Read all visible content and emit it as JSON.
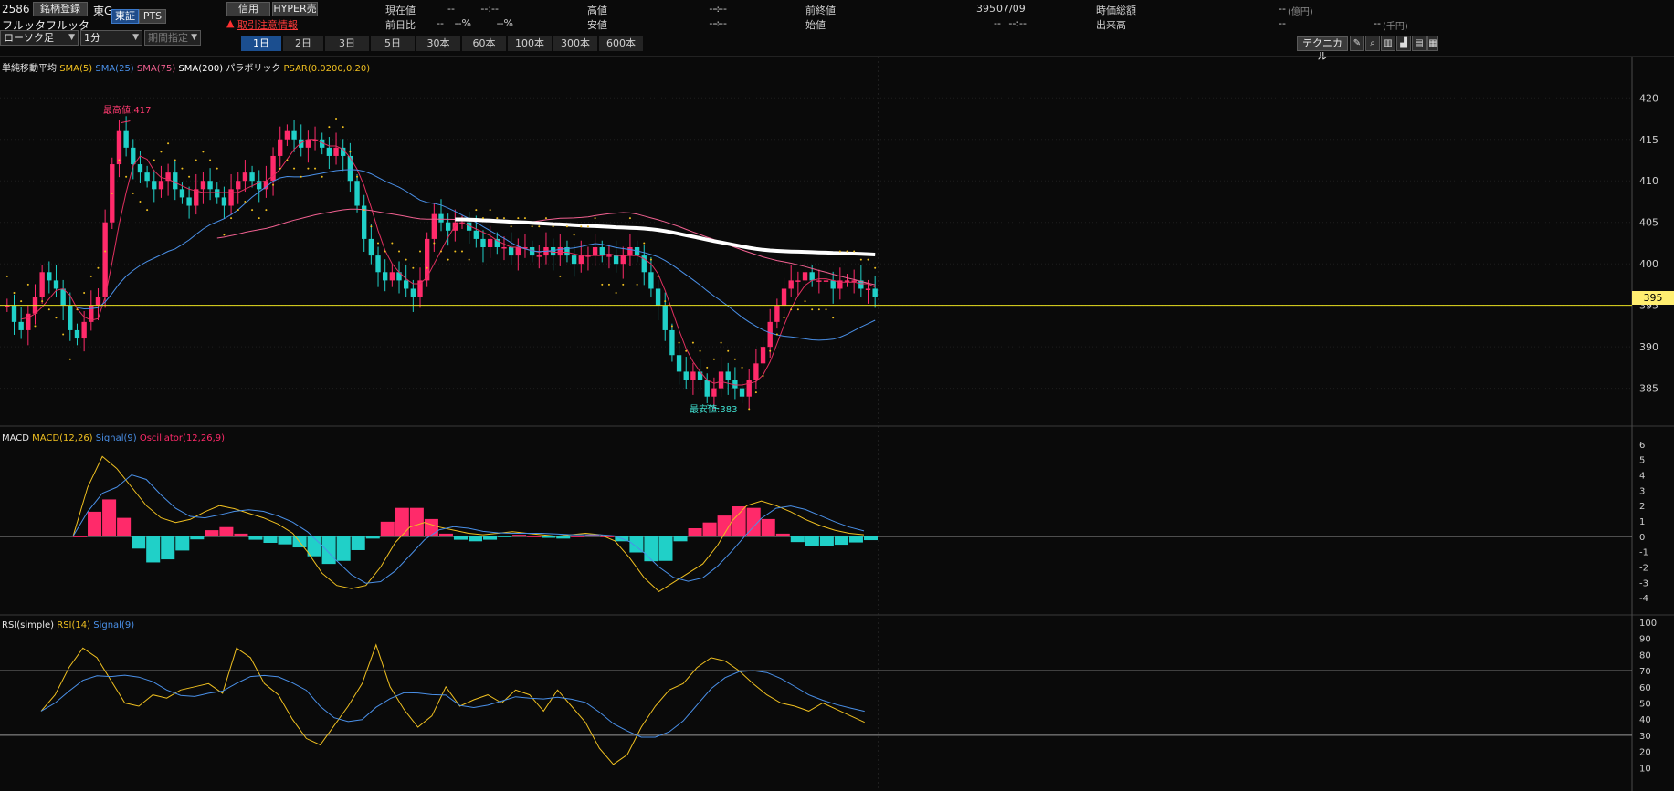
{
  "header": {
    "code": "2586",
    "register_label": "銘柄登録",
    "market": "東G",
    "exchange_tabs": [
      "東証",
      "PTS"
    ],
    "name": "フルッタフルッタ",
    "margin_button": "信用",
    "hyper_button": "HYPER売",
    "caution_text": "取引注意情報",
    "quotes": {
      "current_label": "現在値",
      "current_value": "--",
      "current_time": "--:--",
      "change_label": "前日比",
      "change_value": "--",
      "change_unit": "%",
      "change_pct": "--%",
      "high_label": "高値",
      "high_value": "--",
      "high_time": "--:--",
      "low_label": "安値",
      "low_value": "--",
      "low_time": "--:--",
      "prev_close_label": "前終値",
      "prev_close_value": "395",
      "prev_close_date": "07/09",
      "open_label": "始値",
      "open_value": "--",
      "open_time": "--:--",
      "market_cap_label": "時価総額",
      "market_cap_value": "--",
      "market_cap_unit": "(億円)",
      "volume_label": "出来高",
      "volume_value": "--",
      "volume_value2": "--",
      "volume_unit": "(千円)"
    }
  },
  "toolbar": {
    "chart_type": "ローソク足",
    "interval": "1分",
    "period": "期間指定",
    "ranges": [
      "1日",
      "2日",
      "3日",
      "5日",
      "30本",
      "60本",
      "100本",
      "300本",
      "600本"
    ],
    "active_range": 0,
    "technical_label": "テクニカル"
  },
  "main_chart": {
    "legend": {
      "title": "単純移動平均",
      "sma5": "SMA(5)",
      "sma25": "SMA(25)",
      "sma75": "SMA(75)",
      "sma200": "SMA(200)",
      "parabolic": "パラボリック",
      "psar": "PSAR(0.0200,0.20)"
    },
    "high_marker": "最高値:417",
    "low_marker": "最安値:383",
    "current_price_label": "395",
    "y_ticks": [
      "420",
      "415",
      "410",
      "405",
      "400",
      "395",
      "390",
      "385"
    ]
  },
  "macd_panel": {
    "legend": {
      "title": "MACD",
      "macd": "MACD(12,26)",
      "signal": "Signal(9)",
      "osc": "Oscillator(12,26,9)"
    },
    "y_ticks": [
      "6",
      "5",
      "4",
      "3",
      "2",
      "1",
      "0",
      "-1",
      "-2",
      "-3",
      "-4"
    ]
  },
  "rsi_panel": {
    "legend": {
      "title": "RSI(simple)",
      "rsi": "RSI(14)",
      "signal": "Signal(9)"
    },
    "y_ticks": [
      "100",
      "90",
      "80",
      "70",
      "60",
      "50",
      "40",
      "30",
      "20",
      "10"
    ]
  },
  "colors": {
    "sma5": "#e23060",
    "sma25": "#4a90e8",
    "sma75": "#f06090",
    "sma200": "#ffffff",
    "psar": "#f0c020",
    "up": "#ff2a6a",
    "down": "#20d0c8",
    "accent": "#1f4c8a"
  },
  "chart_data": {
    "type": "line",
    "series": [
      {
        "name": "SMA(5)"
      },
      {
        "name": "SMA(25)"
      },
      {
        "name": "SMA(75)"
      },
      {
        "name": "SMA(200)"
      },
      {
        "name": "PSAR(0.0200,0.20)"
      }
    ],
    "price_range": [
      381,
      423
    ],
    "close_values": [
      395,
      393,
      392,
      394,
      396,
      399,
      398,
      397,
      395,
      392,
      391,
      393,
      395,
      396,
      405,
      412,
      416,
      414,
      412,
      411,
      410,
      409,
      410,
      411,
      409,
      408,
      407,
      409,
      410,
      409,
      408,
      407,
      409,
      410,
      411,
      410,
      409,
      410,
      413,
      415,
      416,
      415,
      414,
      415,
      415,
      414,
      413,
      414,
      413,
      410,
      407,
      403,
      401,
      399,
      398,
      399,
      398,
      397,
      396,
      398,
      403,
      406,
      405,
      404,
      405,
      405,
      404,
      403,
      402,
      403,
      402,
      402,
      401,
      402,
      402,
      401,
      401,
      402,
      401,
      402,
      401,
      400,
      401,
      401,
      402,
      401,
      401,
      400,
      401,
      402,
      401,
      399,
      397,
      395,
      392,
      389,
      387,
      386,
      387,
      386,
      384,
      385,
      387,
      386,
      385,
      384,
      386,
      388,
      390,
      393,
      395,
      397,
      398,
      398,
      399,
      398,
      398,
      398,
      397,
      398,
      398,
      398,
      397,
      397,
      396
    ],
    "high": 417,
    "low": 383,
    "last": 395,
    "macd_range": [
      -5,
      7
    ],
    "macd": [
      0,
      3.2,
      5.2,
      4.4,
      3.2,
      2.0,
      1.2,
      0.9,
      1.1,
      1.6,
      2.0,
      1.8,
      1.5,
      1.2,
      0.8,
      0.2,
      -1.0,
      -2.4,
      -3.2,
      -3.4,
      -3.2,
      -2.0,
      -0.4,
      0.6,
      0.9,
      0.6,
      0.4,
      0.2,
      0.1,
      0.2,
      0.3,
      0.2,
      0.1,
      0.0,
      0.1,
      0.2,
      0.1,
      -0.3,
      -1.4,
      -2.7,
      -3.6,
      -3.0,
      -2.4,
      -1.8,
      -0.6,
      1.0,
      2.0,
      2.3,
      2.0,
      1.6,
      1.1,
      0.7,
      0.4,
      0.2,
      0.1
    ],
    "rsi_range": [
      0,
      100
    ],
    "rsi": [
      45,
      55,
      72,
      84,
      78,
      64,
      50,
      48,
      55,
      53,
      58,
      60,
      62,
      56,
      84,
      78,
      62,
      55,
      40,
      28,
      24,
      36,
      48,
      62,
      86,
      60,
      46,
      35,
      42,
      60,
      48,
      52,
      55,
      50,
      58,
      55,
      45,
      58,
      48,
      38,
      22,
      12,
      18,
      35,
      48,
      58,
      62,
      72,
      78,
      76,
      70,
      62,
      55,
      50,
      48,
      45,
      50,
      46,
      42,
      38
    ]
  }
}
